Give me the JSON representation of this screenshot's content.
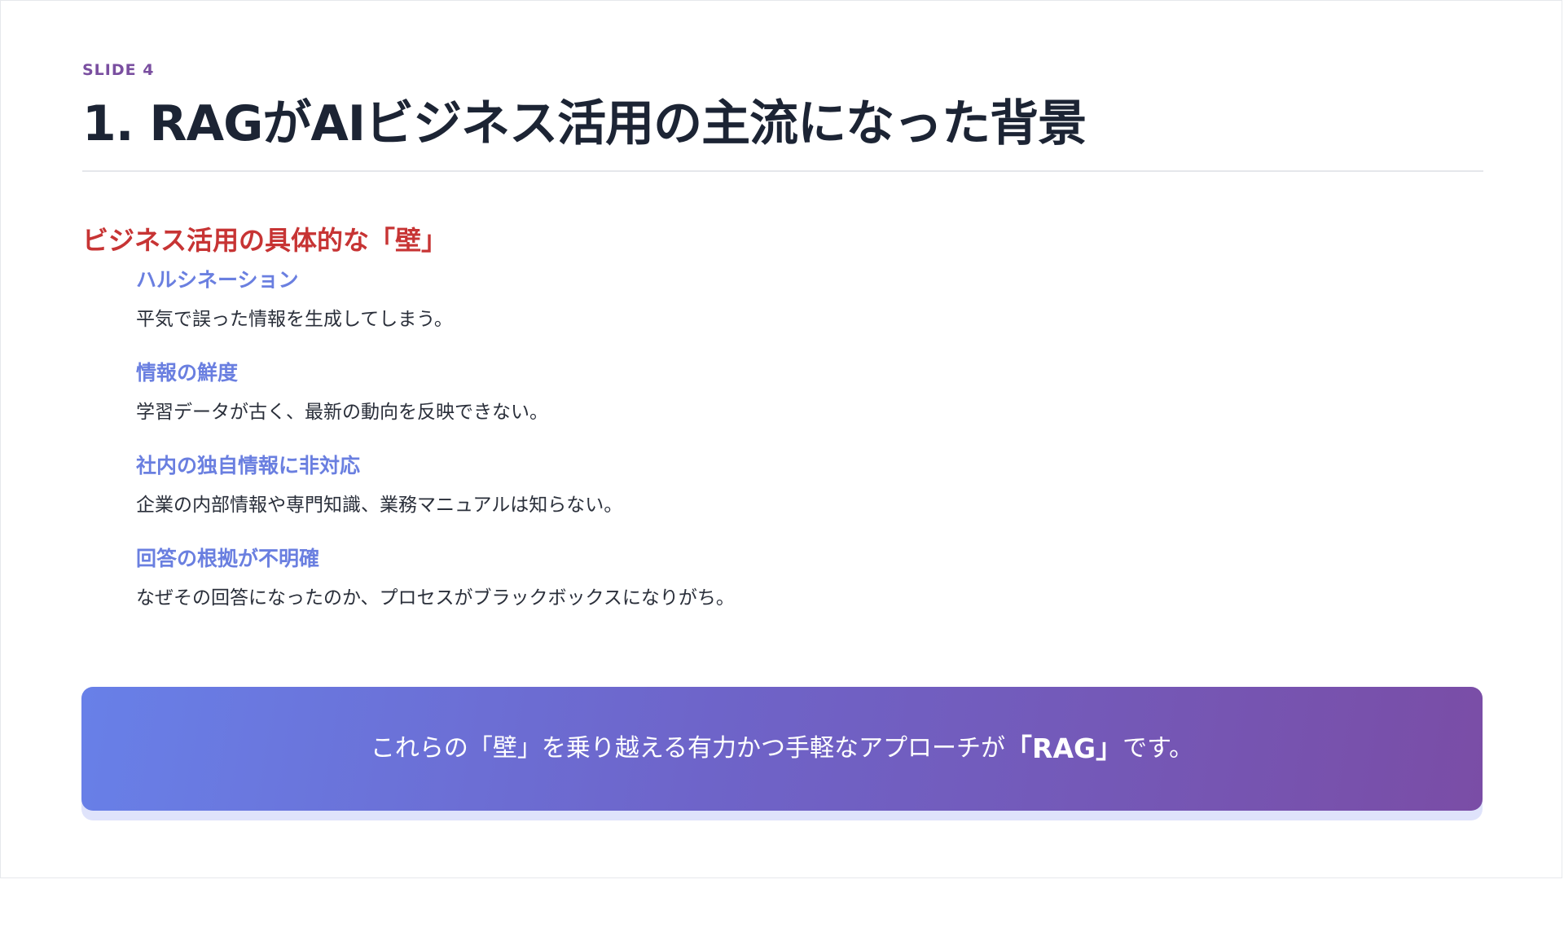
{
  "slide": {
    "label": "SLIDE 4",
    "title": "1. RAGがAIビジネス活用の主流になった背景"
  },
  "section": {
    "heading": "ビジネス活用の具体的な「壁」",
    "items": [
      {
        "title": "ハルシネーション",
        "desc": "平気で誤った情報を生成してしまう。"
      },
      {
        "title": "情報の鮮度",
        "desc": "学習データが古く、最新の動向を反映できない。"
      },
      {
        "title": "社内の独自情報に非対応",
        "desc": "企業の内部情報や専門知識、業務マニュアルは知らない。"
      },
      {
        "title": "回答の根拠が不明確",
        "desc": "なぜその回答になったのか、プロセスがブラックボックスになりがち。"
      }
    ]
  },
  "callout": {
    "text_before": "これらの「壁」を乗り越える有力かつ手軽なアプローチが",
    "text_emphasis": "「RAG」",
    "text_after": "です。"
  },
  "colors": {
    "label": "#7a4fa0",
    "title": "#1c2434",
    "section_heading": "#c73434",
    "item_title": "#6a7fe0",
    "callout_start": "#6880e8",
    "callout_end": "#7a4da6"
  }
}
